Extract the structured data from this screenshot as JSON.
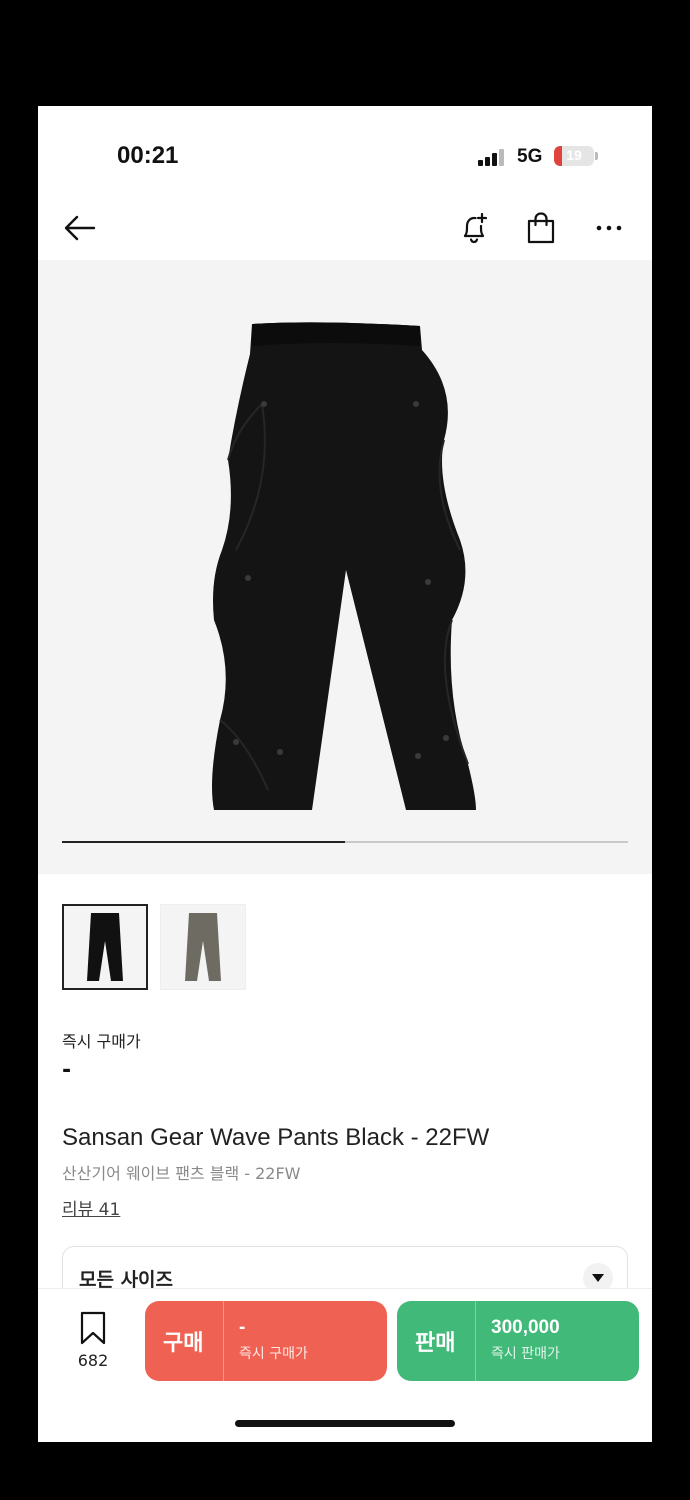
{
  "status_bar": {
    "time": "00:21",
    "network": "5G",
    "battery": "19",
    "battery_level_percent": 19
  },
  "nav": {
    "back_icon": "arrow-left-icon",
    "alert_icon": "bell-plus-icon",
    "cart_icon": "shopping-bag-icon",
    "more_icon": "more-horizontal-icon"
  },
  "gallery": {
    "image_count": 2,
    "current_index": 1
  },
  "thumbnails": [
    {
      "color": "#111111",
      "active": true
    },
    {
      "color": "#6e6c62",
      "active": false
    }
  ],
  "product": {
    "price_label": "즉시 구매가",
    "price_value": "-",
    "title_en": "Sansan Gear Wave Pants Black - 22FW",
    "title_ko": "산산기어 웨이브 팬츠 블랙 - 22FW",
    "reviews": "리뷰 41"
  },
  "size_select": {
    "label": "모든 사이즈"
  },
  "bottom_bar": {
    "bookmark_count": "682",
    "buy": {
      "label": "구매",
      "value": "-",
      "sub": "즉시 구매가",
      "color": "#ef6253"
    },
    "sell": {
      "label": "판매",
      "value": "300,000",
      "sub": "즉시 판매가",
      "color": "#41b979"
    }
  }
}
